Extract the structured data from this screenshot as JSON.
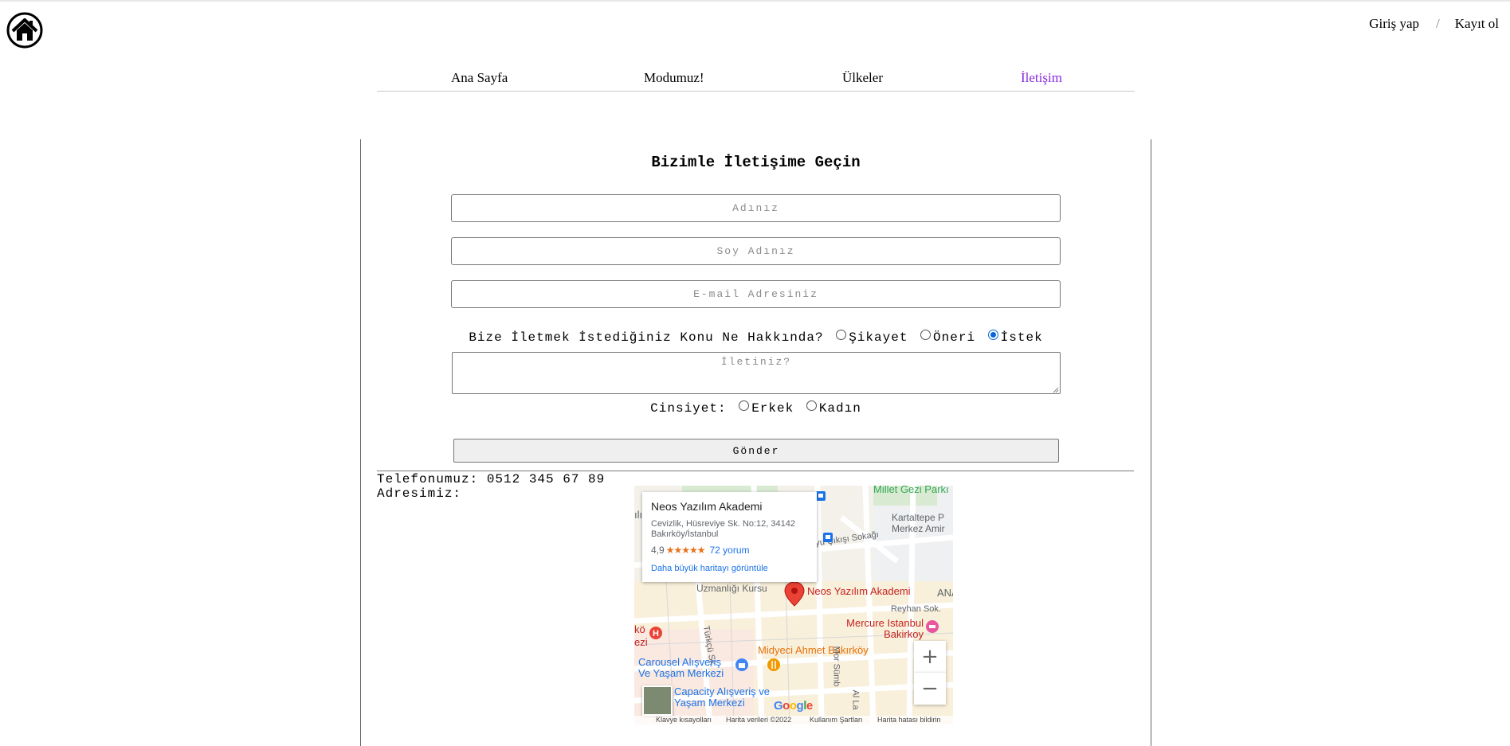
{
  "header": {
    "logo_icon": "home-icon",
    "login_label": "Giriş yap",
    "separator": "/",
    "register_label": "Kayıt ol"
  },
  "nav": {
    "items": [
      {
        "label": "Ana Sayfa"
      },
      {
        "label": "Modumuz!"
      },
      {
        "label": "Ülkeler"
      },
      {
        "label": "İletişim",
        "active": true
      }
    ],
    "active_color": "#8a2be2"
  },
  "form": {
    "title": "Bizimle İletişime Geçin",
    "first_name_placeholder": "Adınız",
    "last_name_placeholder": "Soy Adınız",
    "email_placeholder": "E-mail Adresiniz",
    "topic_question": "Bize İletmek İstediğiniz Konu Ne Hakkında?",
    "topic_options": [
      {
        "label": "Şikayet",
        "selected": false
      },
      {
        "label": "Öneri",
        "selected": false
      },
      {
        "label": "İstek",
        "selected": true
      }
    ],
    "message_placeholder": "İletiniz?",
    "gender_label": "Cinsiyet:",
    "gender_options": [
      {
        "label": "Erkek",
        "selected": false
      },
      {
        "label": "Kadın",
        "selected": false
      }
    ],
    "submit_label": "Gönder"
  },
  "contact": {
    "phone_line": "Telefonumuz: 0512 345 67 89",
    "address_label": "Adresimiz:"
  },
  "map": {
    "place_name": "Neos Yazılım Akademi",
    "place_address": "Cevizlik, Hüsreviye Sk. No:12, 34142 Bakırköy/İstanbul",
    "rating": "4,9",
    "stars": "★★★★★",
    "reviews": "72 yorum",
    "larger_map_link": "Daha büyük haritayı görüntüle",
    "labels": {
      "park": "Millet Gezi Parkı",
      "kartaltepe": "Kartaltepe P Merkez Amir",
      "street1": "yu Çıkışı Sokağı",
      "course": "Uzmanlığı Kursu",
      "pin": "Neos Yazılım Akademi",
      "ana": "ANA",
      "reyhan": "Reyhan Sok.",
      "mercure": "Mercure Istanbul Bakirkoy",
      "turkcu": "Türkçü Sk.",
      "midyeci": "Midyeci Ahmet Bakırköy",
      "carousel": "Carousel Alışveriş Ve Yaşam Merkezi",
      "capacity": "Capacity Alışveriş ve Yaşam Merkezi",
      "mor": "Mor Sümb",
      "ali": "Al La",
      "left1": "ılı",
      "left2": "kö",
      "left3": "ezi"
    },
    "google_logo": "Google",
    "zoom_in": "+",
    "zoom_out": "−",
    "attribution": {
      "shortcuts": "Klavye kısayolları",
      "data": "Harita verileri ©2022",
      "terms": "Kullanım Şartları",
      "report": "Harita hatası bildirin"
    },
    "colors": {
      "pin": "#ea4335",
      "poi_orange": "#e8710a",
      "poi_blue": "#1a73e8",
      "park_green": "#34a853"
    }
  }
}
